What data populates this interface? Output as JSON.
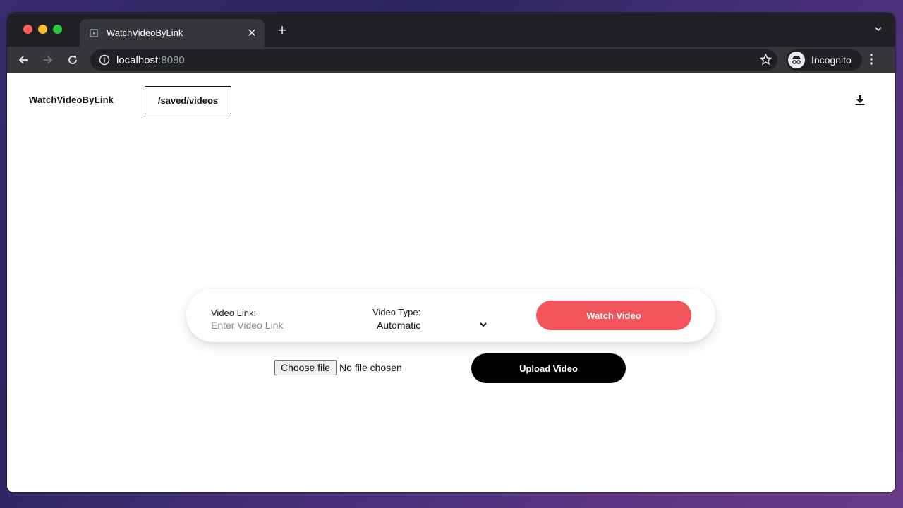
{
  "browser": {
    "tab_title": "WatchVideoByLink",
    "url_host": "localhost",
    "url_port": ":8080",
    "profile_label": "Incognito",
    "traffic_colors": [
      "#ff5f57",
      "#febc2e",
      "#28c840"
    ]
  },
  "nav": {
    "brand": "WatchVideoByLink",
    "saved_link": "/saved/videos",
    "download_icon": "download-icon"
  },
  "form": {
    "link_label": "Video Link:",
    "link_placeholder": "Enter Video Link",
    "link_value": "",
    "type_label": "Video Type:",
    "type_selected": "Automatic",
    "watch_label": "Watch Video",
    "watch_color": "#f2545b"
  },
  "upload": {
    "choose_label": "Choose file",
    "file_status": "No file chosen",
    "upload_label": "Upload Video"
  }
}
